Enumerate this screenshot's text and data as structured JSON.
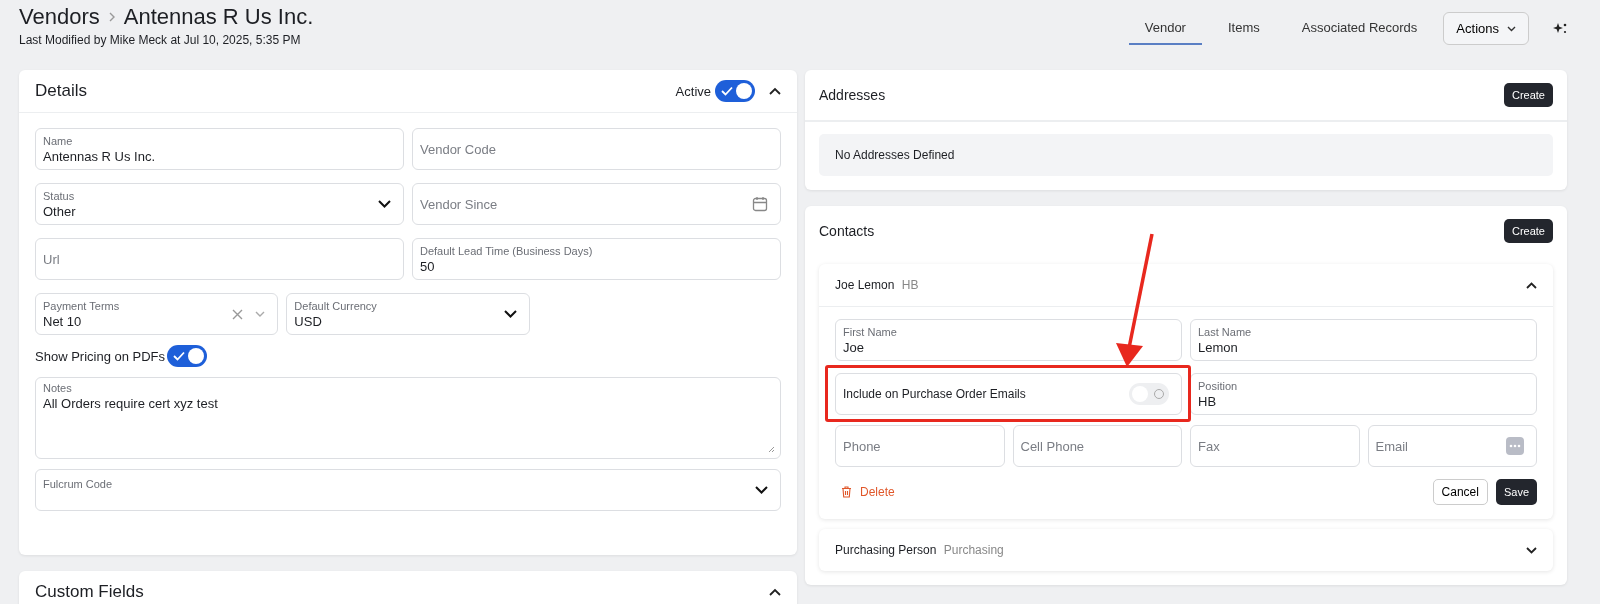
{
  "breadcrumb": {
    "parent": "Vendors",
    "current": "Antennas R Us Inc."
  },
  "last_modified": "Last Modified by Mike Meck at Jul 10, 2025, 5:35 PM",
  "tabs": [
    {
      "label": "Vendor",
      "selected": true
    },
    {
      "label": "Items",
      "selected": false
    },
    {
      "label": "Associated Records",
      "selected": false
    }
  ],
  "actions_button": "Actions",
  "details": {
    "title": "Details",
    "active_label": "Active",
    "active": true,
    "expanded": true,
    "fields": [
      {
        "kind": "text",
        "label": "Name",
        "value": "Antennas R Us Inc."
      },
      {
        "kind": "text",
        "placeholder": "Vendor Code"
      },
      {
        "kind": "select",
        "label": "Status",
        "value": "Other"
      },
      {
        "kind": "date",
        "placeholder": "Vendor Since"
      },
      {
        "kind": "text",
        "placeholder": "Url"
      },
      {
        "kind": "text",
        "label": "Default Lead Time (Business Days)",
        "value": "50"
      },
      {
        "kind": "combo",
        "label": "Payment Terms",
        "value": "Net 10"
      },
      {
        "kind": "select",
        "label": "Default Currency",
        "value": "USD"
      }
    ],
    "pricing_label": "Show Pricing on PDFs",
    "pricing_on": true,
    "notes": {
      "label": "Notes",
      "value": "All Orders require cert xyz test"
    },
    "fulcrum": {
      "label": "Fulcrum Code"
    }
  },
  "custom_fields": {
    "title": "Custom Fields",
    "expanded": true
  },
  "addresses": {
    "title": "Addresses",
    "create": "Create",
    "empty": "No Addresses Defined"
  },
  "contacts": {
    "title": "Contacts",
    "create": "Create",
    "items": [
      {
        "name": "Joe Lemon",
        "role": "HB",
        "expanded": true,
        "first_name": {
          "label": "First Name",
          "value": "Joe"
        },
        "last_name": {
          "label": "Last Name",
          "value": "Lemon"
        },
        "po_emails": {
          "label": "Include on Purchase Order Emails",
          "on": false
        },
        "position": {
          "label": "Position",
          "value": "HB"
        },
        "phones": [
          {
            "kind": "text",
            "placeholder": "Phone"
          },
          {
            "kind": "text",
            "placeholder": "Cell Phone"
          },
          {
            "kind": "text",
            "placeholder": "Fax"
          },
          {
            "kind": "email",
            "placeholder": "Email"
          }
        ],
        "delete": "Delete",
        "cancel": "Cancel",
        "save": "Save"
      },
      {
        "name": "Purchasing Person",
        "role": "Purchasing",
        "expanded": false
      }
    ]
  }
}
